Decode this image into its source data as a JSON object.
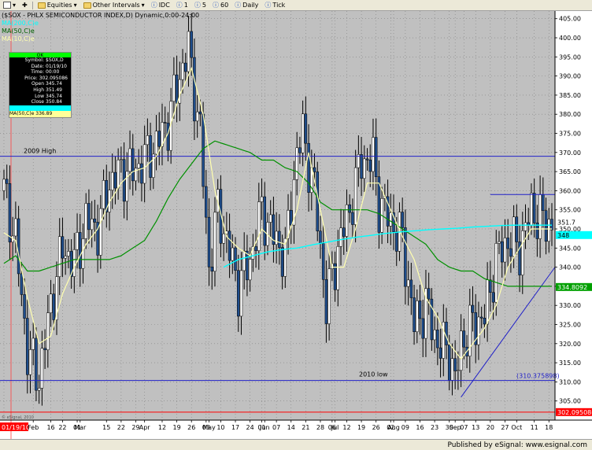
{
  "toolbar": {
    "equities": "Equities",
    "other_intervals": "Other Intervals",
    "idc": "IDC",
    "i1": "1",
    "i5": "5",
    "i60": "60",
    "daily": "Daily",
    "tick": "Tick"
  },
  "header": {
    "title": "($SOX - PHLX SEMICONDUCTOR INDEX,D) Dynamic,0:00-24:00",
    "ma200": "MA(200,C)e",
    "ma50": "MA(50,C)e",
    "ma10": "MA(10,C)e"
  },
  "data_window": {
    "ok": "OK",
    "rows": [
      {
        "k": "Symbol:",
        "v": "$SOX,D"
      },
      {
        "k": "Date:",
        "v": "01/19/10"
      },
      {
        "k": "Time:",
        "v": "00:00"
      },
      {
        "k": "Price:",
        "v": "302.095086"
      },
      {
        "k": "Open",
        "v": "345.74"
      },
      {
        "k": "High",
        "v": "351.49"
      },
      {
        "k": "Low",
        "v": "345.74"
      },
      {
        "k": "Close",
        "v": "350.84"
      }
    ],
    "ma200": "MA(200,C)e",
    "ma50": "MA(50,C)e 336.89"
  },
  "status": {
    "published": "Published by eSignal: www.esignal.com",
    "watermark": "© eSignal, 2010"
  },
  "colors": {
    "plot_bg": "#c0c0c0",
    "candle_up": "#ffffff",
    "candle_down": "#1e4d8c",
    "ma10": "#ffffb0",
    "ma50": "#009000",
    "ma200": "#00ffff",
    "hline": "#2020c8",
    "price_line": "#ff0000"
  },
  "chart_data": {
    "type": "candlestick",
    "y_axis": {
      "min": 300,
      "max": 407,
      "ticks": [
        305,
        310,
        315,
        320,
        325,
        330,
        335,
        340,
        345,
        350,
        355,
        360,
        365,
        370,
        375,
        380,
        385,
        390,
        395,
        400,
        405
      ]
    },
    "x_labels": [
      {
        "label": "01/19/10",
        "i": 0
      },
      {
        "label": "Feb",
        "i": 10
      },
      {
        "label": "16",
        "i": 16
      },
      {
        "label": "22",
        "i": 20
      },
      {
        "label": "01",
        "i": 25
      },
      {
        "label": "Mar",
        "i": 26
      },
      {
        "label": "15",
        "i": 35
      },
      {
        "label": "22",
        "i": 40
      },
      {
        "label": "29",
        "i": 45
      },
      {
        "label": "Apr",
        "i": 48
      },
      {
        "label": "12",
        "i": 54
      },
      {
        "label": "19",
        "i": 59
      },
      {
        "label": "26",
        "i": 64
      },
      {
        "label": "03",
        "i": 69
      },
      {
        "label": "May",
        "i": 70
      },
      {
        "label": "10",
        "i": 74
      },
      {
        "label": "17",
        "i": 79
      },
      {
        "label": "24",
        "i": 84
      },
      {
        "label": "01",
        "i": 88
      },
      {
        "label": "Jun",
        "i": 89
      },
      {
        "label": "07",
        "i": 93
      },
      {
        "label": "14",
        "i": 98
      },
      {
        "label": "21",
        "i": 103
      },
      {
        "label": "28",
        "i": 108
      },
      {
        "label": "06",
        "i": 112
      },
      {
        "label": "Jul",
        "i": 113
      },
      {
        "label": "12",
        "i": 117
      },
      {
        "label": "19",
        "i": 122
      },
      {
        "label": "26",
        "i": 127
      },
      {
        "label": "02",
        "i": 132
      },
      {
        "label": "Aug",
        "i": 133
      },
      {
        "label": "09",
        "i": 137
      },
      {
        "label": "16",
        "i": 142
      },
      {
        "label": "23",
        "i": 147
      },
      {
        "label": "30",
        "i": 152
      },
      {
        "label": "Sep",
        "i": 154
      },
      {
        "label": "07",
        "i": 157
      },
      {
        "label": "13",
        "i": 161
      },
      {
        "label": "20",
        "i": 166
      },
      {
        "label": "27",
        "i": 171
      },
      {
        "label": "Oct",
        "i": 175
      },
      {
        "label": "11",
        "i": 181
      },
      {
        "label": "18",
        "i": 186
      }
    ],
    "last_bar_index": 187,
    "annotations": {
      "high_2009": {
        "label": "2009 High",
        "value": 369.0
      },
      "low_2010": {
        "label": "2010 low",
        "value": 310.375898,
        "tag": "(310.375898)"
      },
      "resistance": {
        "value": 359.0,
        "from": 166,
        "to": 188
      },
      "trendline": {
        "from": [
          156,
          306
        ],
        "to": [
          189,
          340
        ]
      },
      "price_line": {
        "value": 302.095086,
        "tag": "302.095086"
      },
      "ma50_tag": "334.8092",
      "price_tag": "351.7",
      "ma200_tag": "348"
    },
    "anchors": {
      "close": [
        [
          0,
          360
        ],
        [
          4,
          347
        ],
        [
          8,
          318
        ],
        [
          12,
          311
        ],
        [
          16,
          330
        ],
        [
          20,
          345
        ],
        [
          24,
          341
        ],
        [
          28,
          352
        ],
        [
          32,
          350
        ],
        [
          36,
          362
        ],
        [
          40,
          365
        ],
        [
          44,
          365
        ],
        [
          48,
          368
        ],
        [
          52,
          372
        ],
        [
          56,
          378
        ],
        [
          60,
          390
        ],
        [
          63,
          397
        ],
        [
          67,
          375
        ],
        [
          70,
          340
        ],
        [
          73,
          355
        ],
        [
          76,
          347
        ],
        [
          80,
          335
        ],
        [
          84,
          342
        ],
        [
          88,
          355
        ],
        [
          92,
          348
        ],
        [
          96,
          343
        ],
        [
          100,
          370
        ],
        [
          102,
          375
        ],
        [
          106,
          360
        ],
        [
          110,
          330
        ],
        [
          114,
          345
        ],
        [
          118,
          355
        ],
        [
          122,
          368
        ],
        [
          126,
          368
        ],
        [
          128,
          357
        ],
        [
          132,
          352
        ],
        [
          136,
          347
        ],
        [
          140,
          325
        ],
        [
          144,
          330
        ],
        [
          148,
          320
        ],
        [
          152,
          318
        ],
        [
          154,
          310
        ],
        [
          156,
          320
        ],
        [
          160,
          325
        ],
        [
          164,
          327
        ],
        [
          168,
          342
        ],
        [
          172,
          347
        ],
        [
          176,
          345
        ],
        [
          180,
          355
        ],
        [
          184,
          352
        ],
        [
          187,
          350.84
        ]
      ],
      "ma10": [
        [
          0,
          349
        ],
        [
          4,
          347
        ],
        [
          8,
          332
        ],
        [
          12,
          320
        ],
        [
          16,
          322
        ],
        [
          20,
          333
        ],
        [
          24,
          340
        ],
        [
          28,
          346
        ],
        [
          32,
          350
        ],
        [
          36,
          357
        ],
        [
          40,
          362
        ],
        [
          44,
          365
        ],
        [
          48,
          366
        ],
        [
          52,
          369
        ],
        [
          56,
          375
        ],
        [
          60,
          385
        ],
        [
          64,
          392
        ],
        [
          68,
          380
        ],
        [
          72,
          360
        ],
        [
          76,
          348
        ],
        [
          80,
          345
        ],
        [
          84,
          343
        ],
        [
          88,
          350
        ],
        [
          92,
          347
        ],
        [
          96,
          346
        ],
        [
          100,
          355
        ],
        [
          104,
          370
        ],
        [
          108,
          355
        ],
        [
          112,
          340
        ],
        [
          116,
          340
        ],
        [
          120,
          350
        ],
        [
          124,
          362
        ],
        [
          128,
          362
        ],
        [
          132,
          355
        ],
        [
          136,
          348
        ],
        [
          140,
          342
        ],
        [
          144,
          332
        ],
        [
          148,
          327
        ],
        [
          152,
          320
        ],
        [
          156,
          316
        ],
        [
          160,
          320
        ],
        [
          164,
          324
        ],
        [
          168,
          330
        ],
        [
          172,
          340
        ],
        [
          176,
          345
        ],
        [
          180,
          350
        ],
        [
          184,
          350
        ],
        [
          187,
          350
        ]
      ],
      "ma50": [
        [
          0,
          341
        ],
        [
          4,
          343
        ],
        [
          8,
          339
        ],
        [
          12,
          339
        ],
        [
          16,
          340
        ],
        [
          20,
          341
        ],
        [
          24,
          342
        ],
        [
          28,
          342
        ],
        [
          32,
          342
        ],
        [
          36,
          342
        ],
        [
          40,
          343
        ],
        [
          44,
          345
        ],
        [
          48,
          347
        ],
        [
          52,
          352
        ],
        [
          56,
          358
        ],
        [
          60,
          363
        ],
        [
          64,
          367
        ],
        [
          68,
          371
        ],
        [
          72,
          373
        ],
        [
          76,
          372
        ],
        [
          80,
          371
        ],
        [
          84,
          370
        ],
        [
          88,
          368
        ],
        [
          92,
          368
        ],
        [
          96,
          366
        ],
        [
          100,
          365
        ],
        [
          104,
          362
        ],
        [
          108,
          357
        ],
        [
          112,
          355
        ],
        [
          116,
          355
        ],
        [
          120,
          355
        ],
        [
          124,
          355
        ],
        [
          128,
          354
        ],
        [
          132,
          352
        ],
        [
          136,
          350
        ],
        [
          140,
          348
        ],
        [
          144,
          346
        ],
        [
          148,
          342
        ],
        [
          152,
          340
        ],
        [
          156,
          339
        ],
        [
          160,
          339
        ],
        [
          164,
          337
        ],
        [
          168,
          336
        ],
        [
          172,
          335
        ],
        [
          176,
          335
        ],
        [
          180,
          335
        ],
        [
          184,
          335
        ],
        [
          187,
          335
        ]
      ],
      "ma200": [
        [
          75,
          340
        ],
        [
          80,
          342
        ],
        [
          85,
          343
        ],
        [
          90,
          344
        ],
        [
          95,
          344.6
        ],
        [
          100,
          345
        ],
        [
          105,
          345.8
        ],
        [
          110,
          346.5
        ],
        [
          115,
          347.2
        ],
        [
          120,
          347.8
        ],
        [
          125,
          348.3
        ],
        [
          130,
          348.8
        ],
        [
          135,
          349.2
        ],
        [
          140,
          349.5
        ],
        [
          145,
          349.8
        ],
        [
          150,
          350
        ],
        [
          155,
          350.2
        ],
        [
          160,
          350.5
        ],
        [
          165,
          350.7
        ],
        [
          170,
          350.9
        ],
        [
          175,
          351
        ],
        [
          180,
          351
        ],
        [
          187,
          351
        ]
      ]
    }
  }
}
